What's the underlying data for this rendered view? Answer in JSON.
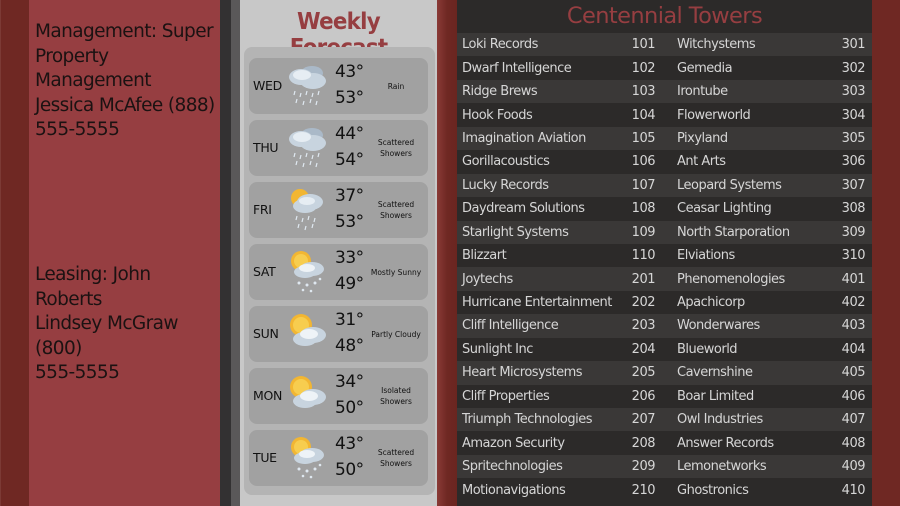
{
  "contacts": {
    "management": "Management: Super\nProperty Management\nJessica McAfee (888)\n555-5555",
    "leasing": "Leasing: John Roberts\nLindsey McGraw (800)\n555-5555"
  },
  "colors": {
    "brand_red": "#963e41",
    "dark_red": "#6f2823",
    "directory_bg": "#2c2a29",
    "row_alt": "#3a3837",
    "weather_bg": "#c8c8c8"
  },
  "weather": {
    "title": "Weekly Forecast",
    "days": [
      {
        "day": "WED",
        "icon": "rain-cloud-icon",
        "high": "43°",
        "low": "53°",
        "condition": "Rain"
      },
      {
        "day": "THU",
        "icon": "rain-cloud-icon",
        "high": "44°",
        "low": "54°",
        "condition": "Scattered Showers"
      },
      {
        "day": "FRI",
        "icon": "sun-rain-cloud-icon",
        "high": "37°",
        "low": "53°",
        "condition": "Scattered Showers"
      },
      {
        "day": "SAT",
        "icon": "sun-cloud-drizzle-icon",
        "high": "33°",
        "low": "49°",
        "condition": "Mostly Sunny"
      },
      {
        "day": "SUN",
        "icon": "sun-cloud-icon",
        "high": "31°",
        "low": "48°",
        "condition": "Partly Cloudy"
      },
      {
        "day": "MON",
        "icon": "sun-cloud-icon",
        "high": "34°",
        "low": "50°",
        "condition": "Isolated Showers"
      },
      {
        "day": "TUE",
        "icon": "sun-cloud-drizzle-icon",
        "high": "43°",
        "low": "50°",
        "condition": "Scattered Showers"
      }
    ]
  },
  "directory": {
    "title": "Centennial Towers",
    "rows": [
      {
        "name1": "Loki Records",
        "suite1": "101",
        "name2": "Witchystems",
        "suite2": "301"
      },
      {
        "name1": "Dwarf Intelligence",
        "suite1": "102",
        "name2": "Gemedia",
        "suite2": "302"
      },
      {
        "name1": "Ridge Brews",
        "suite1": "103",
        "name2": "Irontube",
        "suite2": "303"
      },
      {
        "name1": "Hook Foods",
        "suite1": "104",
        "name2": "Flowerworld",
        "suite2": "304"
      },
      {
        "name1": "Imagination Aviation",
        "suite1": "105",
        "name2": "Pixyland",
        "suite2": "305"
      },
      {
        "name1": "Gorillacoustics",
        "suite1": "106",
        "name2": "Ant Arts",
        "suite2": "306"
      },
      {
        "name1": "Lucky Records",
        "suite1": "107",
        "name2": "Leopard Systems",
        "suite2": "307"
      },
      {
        "name1": "Daydream Solutions",
        "suite1": "108",
        "name2": "Ceasar Lighting",
        "suite2": "308"
      },
      {
        "name1": "Starlight Systems",
        "suite1": "109",
        "name2": "North Starporation",
        "suite2": "309"
      },
      {
        "name1": "Blizzart",
        "suite1": "110",
        "name2": "Elviations",
        "suite2": "310"
      },
      {
        "name1": "Joytechs",
        "suite1": "201",
        "name2": "Phenomenologies",
        "suite2": "401"
      },
      {
        "name1": "Hurricane Entertainment",
        "suite1": "202",
        "name2": "Apachicorp",
        "suite2": "402"
      },
      {
        "name1": "Cliff Intelligence",
        "suite1": "203",
        "name2": "Wonderwares",
        "suite2": "403"
      },
      {
        "name1": "Sunlight Inc",
        "suite1": "204",
        "name2": "Blueworld",
        "suite2": "404"
      },
      {
        "name1": "Heart Microsystems",
        "suite1": "205",
        "name2": "Cavernshine",
        "suite2": "405"
      },
      {
        "name1": "Cliff Properties",
        "suite1": "206",
        "name2": "Boar Limited",
        "suite2": "406"
      },
      {
        "name1": "Triumph Technologies",
        "suite1": "207",
        "name2": "Owl Industries",
        "suite2": "407"
      },
      {
        "name1": "Amazon Security",
        "suite1": "208",
        "name2": "Answer Records",
        "suite2": "408"
      },
      {
        "name1": "Spritechnologies",
        "suite1": "209",
        "name2": "Lemonetworks",
        "suite2": "409"
      },
      {
        "name1": "Motionavigations",
        "suite1": "210",
        "name2": "Ghostronics",
        "suite2": "410"
      }
    ]
  }
}
